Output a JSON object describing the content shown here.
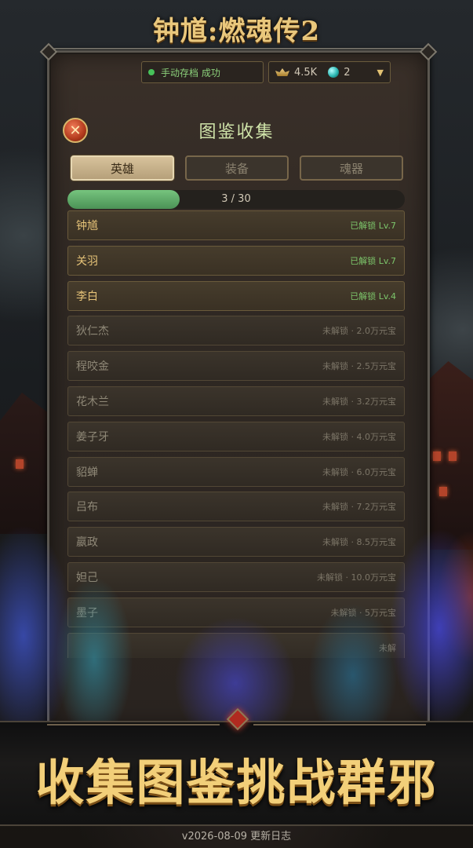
{
  "app": {
    "logo_text": "钟馗:燃魂传2"
  },
  "status_bar": {
    "save_status": "手动存档 成功",
    "gold": "4.5K",
    "gems": "2"
  },
  "panel": {
    "title": "图鉴收集",
    "close_icon": "close-icon",
    "tabs": [
      {
        "label": "英雄",
        "active": true
      },
      {
        "label": "装备",
        "active": false
      },
      {
        "label": "魂器",
        "active": false
      }
    ],
    "progress": {
      "text": "3 / 30",
      "unlocked": 3,
      "total": 30
    }
  },
  "entries": [
    {
      "name": "钟馗",
      "status": "已解锁 Lv.7",
      "unlocked": true
    },
    {
      "name": "关羽",
      "status": "已解锁 Lv.7",
      "unlocked": true
    },
    {
      "name": "李白",
      "status": "已解锁 Lv.4",
      "unlocked": true
    },
    {
      "name": "狄仁杰",
      "status": "未解锁 · 2.0万元宝",
      "unlocked": false
    },
    {
      "name": "程咬金",
      "status": "未解锁 · 2.5万元宝",
      "unlocked": false
    },
    {
      "name": "花木兰",
      "status": "未解锁 · 3.2万元宝",
      "unlocked": false
    },
    {
      "name": "姜子牙",
      "status": "未解锁 · 4.0万元宝",
      "unlocked": false
    },
    {
      "name": "貂蝉",
      "status": "未解锁 · 6.0万元宝",
      "unlocked": false
    },
    {
      "name": "吕布",
      "status": "未解锁 · 7.2万元宝",
      "unlocked": false
    },
    {
      "name": "嬴政",
      "status": "未解锁 · 8.5万元宝",
      "unlocked": false
    },
    {
      "name": "妲己",
      "status": "未解锁 · 10.0万元宝",
      "unlocked": false
    },
    {
      "name": "墨子",
      "status": "未解锁 · 5万元宝",
      "unlocked": false
    },
    {
      "name": "",
      "status": "未解",
      "unlocked": false
    }
  ],
  "banner": {
    "slogan": "收集图鉴挑战群邪"
  },
  "footer": {
    "text": "v2026-08-09 更新日志"
  },
  "colors": {
    "accent_gold": "#e6c378",
    "unlocked_green": "#7cc66b",
    "locked_gray": "#8f8877"
  }
}
